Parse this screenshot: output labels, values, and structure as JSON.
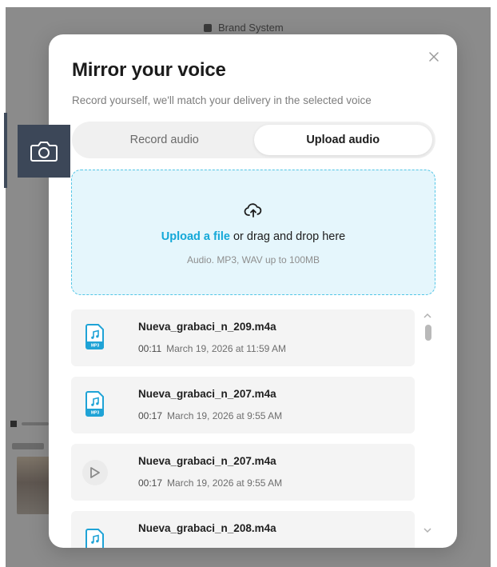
{
  "background": {
    "topbar_label": "Brand System"
  },
  "screenshot_tool": {
    "icon": "camera-icon"
  },
  "modal": {
    "title": "Mirror your voice",
    "subtitle": "Record yourself, we'll match your delivery in the selected voice",
    "close_icon": "close-icon",
    "tabs": [
      {
        "label": "Record audio",
        "active": false
      },
      {
        "label": "Upload audio",
        "active": true
      }
    ],
    "dropzone": {
      "icon": "cloud-upload-icon",
      "link_text": "Upload a file",
      "rest_text": " or drag and drop here",
      "hint": "Audio. MP3, WAV up to 100MB"
    },
    "files": [
      {
        "icon": "mp3-file-icon",
        "name": "Nueva_grabaci_n_209.m4a",
        "duration": "00:11",
        "date": "March 19, 2026 at 11:59 AM"
      },
      {
        "icon": "mp3-file-icon",
        "name": "Nueva_grabaci_n_207.m4a",
        "duration": "00:17",
        "date": "March 19, 2026 at 9:55 AM"
      },
      {
        "icon": "play-icon",
        "name": "Nueva_grabaci_n_207.m4a",
        "duration": "00:17",
        "date": "March 19, 2026 at 9:55 AM"
      },
      {
        "icon": "mp3-file-icon",
        "name": "Nueva_grabaci_n_208.m4a",
        "duration": "",
        "date": ""
      }
    ]
  },
  "colors": {
    "accent": "#14a8d8",
    "dropzone_bg": "#e5f6fc",
    "dropzone_border": "#53c6e6"
  }
}
